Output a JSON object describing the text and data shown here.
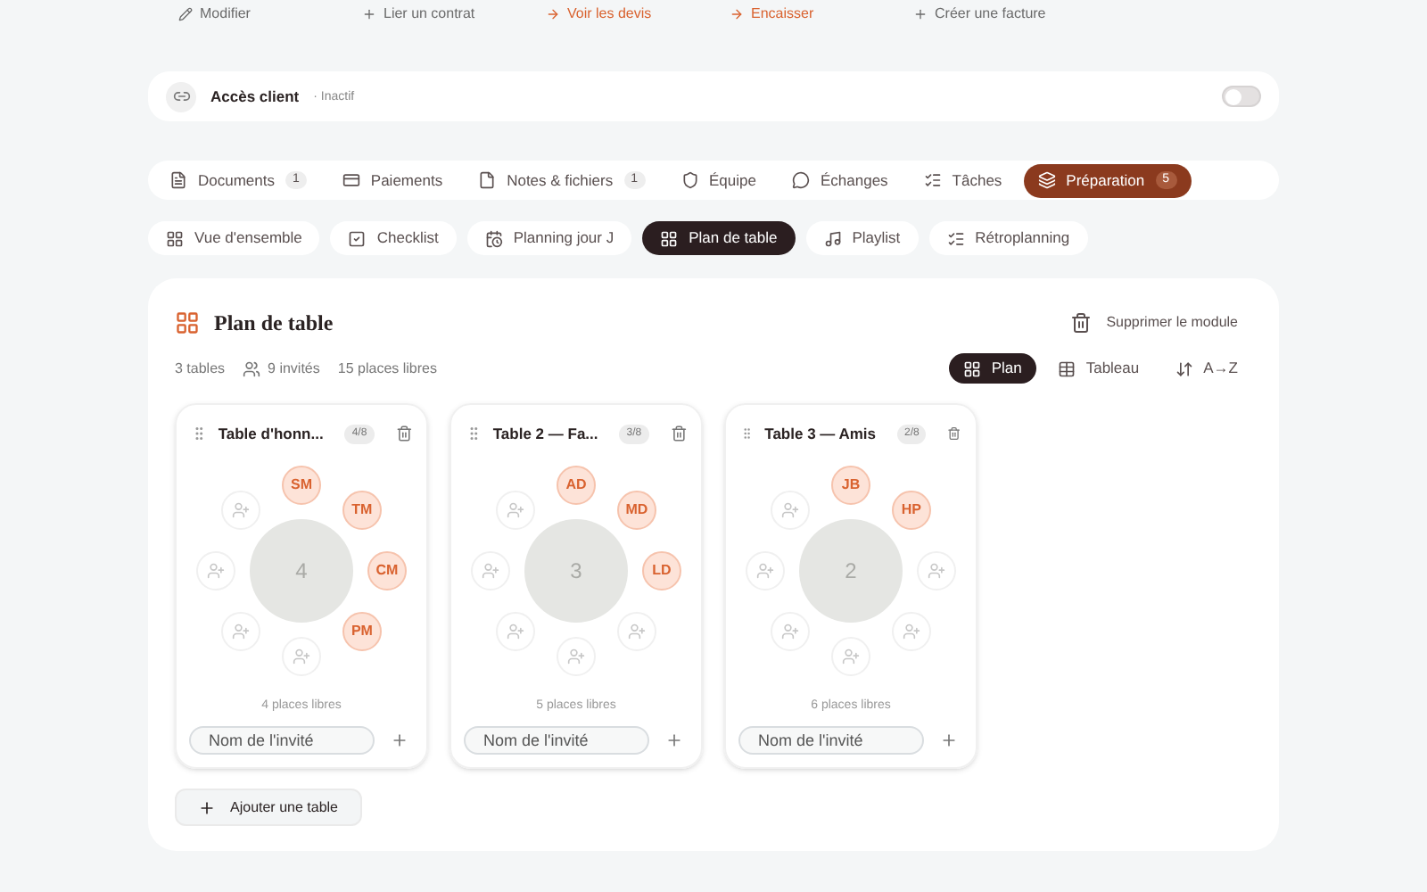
{
  "actions": [
    {
      "kind": "edit",
      "label": "Modifier",
      "accent": false
    },
    {
      "kind": "add",
      "label": "Lier un contrat",
      "accent": false
    },
    {
      "kind": "arrow",
      "label": "Voir les devis",
      "accent": true
    },
    {
      "kind": "arrow",
      "label": "Encaisser",
      "accent": true
    },
    {
      "kind": "add",
      "label": "Créer une facture",
      "accent": false
    }
  ],
  "client_access": {
    "title": "Accès client",
    "status": "· Inactif",
    "on": false
  },
  "tabs": [
    {
      "kind": "file",
      "label": "Documents",
      "count": "1",
      "selected": false
    },
    {
      "kind": "card",
      "label": "Paiements",
      "selected": false
    },
    {
      "kind": "note",
      "label": "Notes & fichiers",
      "count": "1",
      "selected": false
    },
    {
      "kind": "team",
      "label": "Équipe",
      "selected": false
    },
    {
      "kind": "chat",
      "label": "Échanges",
      "selected": false
    },
    {
      "kind": "list",
      "label": "Tâches",
      "selected": false
    },
    {
      "kind": "layers",
      "label": "Préparation",
      "count": "5",
      "selected": true
    }
  ],
  "subtabs": [
    {
      "kind": "grid",
      "label": "Vue d'ensemble",
      "selected": false
    },
    {
      "kind": "check",
      "label": "Checklist",
      "selected": false
    },
    {
      "kind": "calendar",
      "label": "Planning jour J",
      "selected": false
    },
    {
      "kind": "grid",
      "label": "Plan de table",
      "selected": true
    },
    {
      "kind": "music",
      "label": "Playlist",
      "selected": false
    },
    {
      "kind": "list",
      "label": "Rétroplanning",
      "selected": false
    }
  ],
  "module": {
    "title": "Plan de table",
    "delete_label": "Supprimer le module",
    "stats": {
      "tables": "3 tables",
      "guests": "9 invités",
      "free": "15 places libres"
    },
    "views": [
      {
        "kind": "grid",
        "label": "Plan",
        "selected": true
      },
      {
        "kind": "table",
        "label": "Tableau",
        "selected": false
      },
      {
        "kind": "sort",
        "label": "A→Z",
        "selected": false
      }
    ],
    "tables": [
      {
        "name": "Table d'honn...",
        "badge": "4/8",
        "center": "4",
        "free": "4 places libres",
        "input_placeholder": "Nom de l'invité",
        "seats": [
          {
            "occupied": true,
            "initials": "SM"
          },
          {
            "occupied": true,
            "initials": "TM"
          },
          {
            "occupied": true,
            "initials": "CM"
          },
          {
            "occupied": true,
            "initials": "PM"
          },
          {
            "occupied": false
          },
          {
            "occupied": false
          },
          {
            "occupied": false
          },
          {
            "occupied": false
          }
        ]
      },
      {
        "name": "Table 2 — Fa...",
        "badge": "3/8",
        "center": "3",
        "free": "5 places libres",
        "input_placeholder": "Nom de l'invité",
        "seats": [
          {
            "occupied": true,
            "initials": "AD"
          },
          {
            "occupied": true,
            "initials": "MD"
          },
          {
            "occupied": true,
            "initials": "LD"
          },
          {
            "occupied": false
          },
          {
            "occupied": false
          },
          {
            "occupied": false
          },
          {
            "occupied": false
          },
          {
            "occupied": false
          }
        ]
      },
      {
        "name": "Table 3 — Amis",
        "badge": "2/8",
        "center": "2",
        "free": "6 places libres",
        "input_placeholder": "Nom de l'invité",
        "seats": [
          {
            "occupied": true,
            "initials": "JB"
          },
          {
            "occupied": true,
            "initials": "HP"
          },
          {
            "occupied": false
          },
          {
            "occupied": false
          },
          {
            "occupied": false
          },
          {
            "occupied": false
          },
          {
            "occupied": false
          },
          {
            "occupied": false
          }
        ]
      }
    ],
    "add_table": "Ajouter une table"
  }
}
